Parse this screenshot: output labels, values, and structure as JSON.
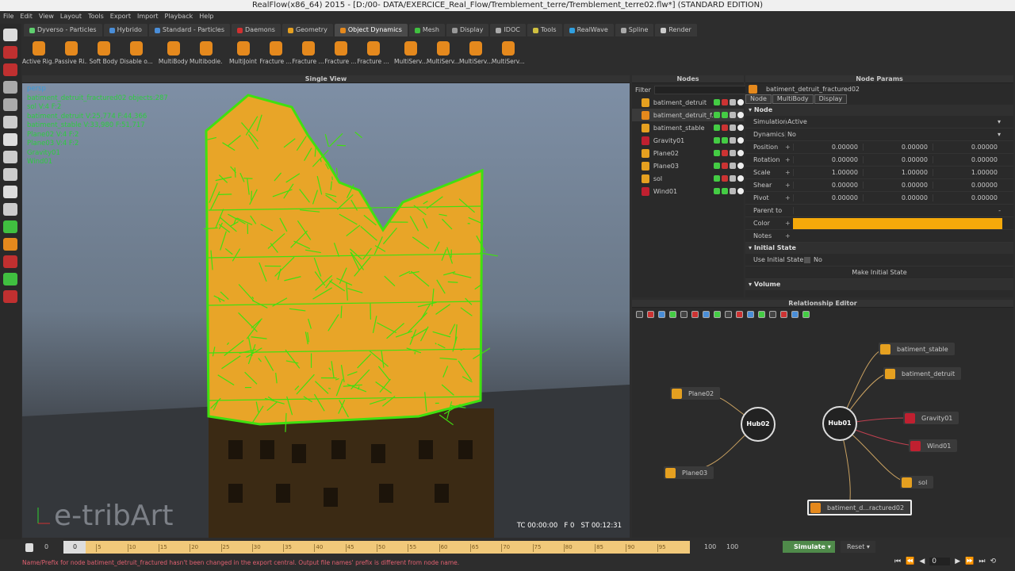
{
  "window": {
    "title": "RealFlow(x86_64) 2015 - [D:/00- DATA/EXERCICE_Real_Flow/Tremblement_terre/Tremblement_terre02.flw*] (STANDARD EDITION)"
  },
  "menu": [
    "File",
    "Edit",
    "View",
    "Layout",
    "Tools",
    "Export",
    "Import",
    "Playback",
    "Help"
  ],
  "tabs": [
    {
      "label": "Dyverso - Particles",
      "c": "#5fcf6f"
    },
    {
      "label": "Hybrido",
      "c": "#4a8ed8"
    },
    {
      "label": "Standard - Particles",
      "c": "#4a8ed8"
    },
    {
      "label": "Daemons",
      "c": "#d03030"
    },
    {
      "label": "Geometry",
      "c": "#e5a020"
    },
    {
      "label": "Object Dynamics",
      "c": "#e5891d",
      "active": true
    },
    {
      "label": "Mesh",
      "c": "#40c040"
    },
    {
      "label": "Display",
      "c": "#999"
    },
    {
      "label": "IDOC",
      "c": "#aaa"
    },
    {
      "label": "Tools",
      "c": "#d0c040"
    },
    {
      "label": "RealWave",
      "c": "#30a0e0"
    },
    {
      "label": "Spline",
      "c": "#aaa"
    },
    {
      "label": "Render",
      "c": "#ccc"
    }
  ],
  "toolbar": [
    "Active Rig...",
    "Passive Ri...",
    "Soft Body",
    "Disable o...",
    "MultiBody",
    "Multibodie...",
    "MultiJoint",
    "Fracture ...",
    "Fracture ...",
    "Fracture ...",
    "Fracture ...",
    "MultiServ...",
    "MultiServ...",
    "MultiServ...",
    "MultiServ..."
  ],
  "viewport": {
    "title": "Single View",
    "camera": "persp",
    "info": [
      "batiment_detruit_fractured02 objects:287",
      "sol V:4 F:2",
      "batiment_detruit V:25,774 F:44,366",
      "batiment_stable V:33,980 F:51,717",
      "Plane02 V:4 F:2",
      "Plane03 V:4 F:2",
      "Gravity01",
      "Wind01"
    ],
    "timecode": "TC 00:00:00   F 0   ST 00:12:31",
    "watermark": "e-tribArt"
  },
  "nodes": {
    "title": "Nodes",
    "filter_label": "Filter",
    "items": [
      {
        "label": "batiment_detruit",
        "c": "#e5a020"
      },
      {
        "label": "batiment_detruit_f...",
        "c": "#e5891d",
        "selected": true
      },
      {
        "label": "batiment_stable",
        "c": "#e5a020"
      },
      {
        "label": "Gravity01",
        "c": "#c02030"
      },
      {
        "label": "Plane02",
        "c": "#e5a020"
      },
      {
        "label": "Plane03",
        "c": "#e5a020"
      },
      {
        "label": "sol",
        "c": "#e5a020"
      },
      {
        "label": "Wind01",
        "c": "#c02030"
      }
    ]
  },
  "params": {
    "title": "Node Params",
    "node_name": "batiment_detruit_fractured02",
    "tabs": [
      "Node",
      "MultiBody",
      "Display"
    ],
    "section_node": "Node",
    "simulation": {
      "label": "Simulation",
      "value": "Active"
    },
    "dynamics": {
      "label": "Dynamics",
      "value": "No"
    },
    "vectors": [
      {
        "label": "Position",
        "v": [
          "0.00000",
          "0.00000",
          "0.00000"
        ]
      },
      {
        "label": "Rotation",
        "v": [
          "0.00000",
          "0.00000",
          "0.00000"
        ]
      },
      {
        "label": "Scale",
        "v": [
          "1.00000",
          "1.00000",
          "1.00000"
        ]
      },
      {
        "label": "Shear",
        "v": [
          "0.00000",
          "0.00000",
          "0.00000"
        ]
      },
      {
        "label": "Pivot",
        "v": [
          "0.00000",
          "0.00000",
          "0.00000"
        ]
      }
    ],
    "parent_label": "Parent to",
    "parent_value": "-",
    "color_label": "Color",
    "color": "#f5a90a",
    "notes_label": "Notes",
    "section_initial": "Initial State",
    "use_initial_label": "Use Initial State",
    "use_initial_value": "No",
    "make_initial": "Make Initial State",
    "section_volume": "Volume"
  },
  "relationship": {
    "title": "Relationship Editor",
    "hub01": "Hub01",
    "hub02": "Hub02",
    "nodes": {
      "stable": "batiment_stable",
      "detruit": "batiment_detruit",
      "gravity": "Gravity01",
      "wind": "Wind01",
      "sol": "sol",
      "fractured": "batiment_d...ractured02",
      "plane02": "Plane02",
      "plane03": "Plane03"
    }
  },
  "timeline": {
    "start": "0",
    "current": "0",
    "ticks": [
      "0",
      "5",
      "10",
      "15",
      "20",
      "25",
      "30",
      "35",
      "40",
      "45",
      "50",
      "55",
      "60",
      "65",
      "70",
      "75",
      "80",
      "85",
      "90",
      "95"
    ],
    "end": "100",
    "end2": "100",
    "frame_field": "0",
    "simulate": "Simulate",
    "reset": "Reset"
  },
  "status": "Name/Prefix for node batiment_detruit_fractured hasn't been changed in the export central. Output file names' prefix is different from node name."
}
